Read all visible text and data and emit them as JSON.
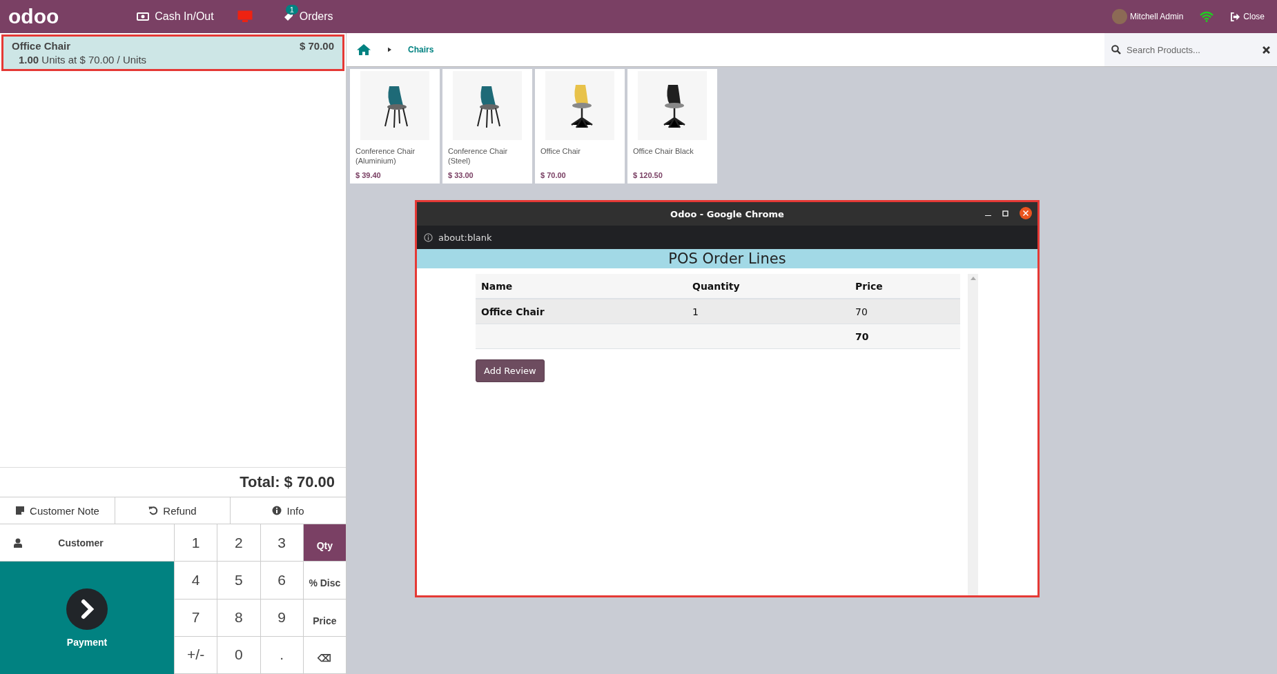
{
  "header": {
    "logo": "odoo",
    "cash_button": "Cash In/Out",
    "orders": {
      "label": "Orders",
      "badge": "1"
    },
    "user": "Mitchell Admin",
    "close": "Close"
  },
  "order_lines": [
    {
      "name": "Office Chair",
      "price": "$ 70.00",
      "quantity": "1.00",
      "detail": "Units at $ 70.00 / Units",
      "selected": true
    }
  ],
  "total": "Total: $ 70.00",
  "control_buttons": [
    {
      "label": "Customer Note",
      "kind": "note"
    },
    {
      "label": "Refund",
      "kind": "refund"
    },
    {
      "label": "Info",
      "kind": "info"
    }
  ],
  "customer_button": "Customer",
  "payment_button": "Payment",
  "numpad": [
    {
      "label": "1",
      "selected": false
    },
    {
      "label": "2",
      "selected": false
    },
    {
      "label": "3",
      "selected": false
    },
    {
      "label": "Qty",
      "selected": true
    },
    {
      "label": "4",
      "selected": false
    },
    {
      "label": "5",
      "selected": false
    },
    {
      "label": "6",
      "selected": false
    },
    {
      "label": "% Disc",
      "selected": false
    },
    {
      "label": "7",
      "selected": false
    },
    {
      "label": "8",
      "selected": false
    },
    {
      "label": "9",
      "selected": false
    },
    {
      "label": "Price",
      "selected": false
    },
    {
      "label": "+/-",
      "selected": false
    },
    {
      "label": "0",
      "selected": false
    },
    {
      "label": ".",
      "selected": false
    },
    {
      "label": "⌫",
      "selected": false
    }
  ],
  "breadcrumb": [
    "Chairs"
  ],
  "search": {
    "placeholder": "Search Products..."
  },
  "products": [
    {
      "name": "Conference Chair (Aluminium)",
      "price": "$ 39.40"
    },
    {
      "name": "Conference Chair (Steel)",
      "price": "$ 33.00"
    },
    {
      "name": "Office Chair",
      "price": "$ 70.00"
    },
    {
      "name": "Office Chair Black",
      "price": "$ 120.50"
    }
  ],
  "popup": {
    "title": "Odoo - Google Chrome",
    "address": "about:blank",
    "heading": "POS Order Lines",
    "table": {
      "columns": [
        "Name",
        "Quantity",
        "Price"
      ],
      "rows": [
        [
          "Office Chair",
          "1",
          "70"
        ]
      ],
      "total": "70"
    },
    "button": "Add Review"
  }
}
